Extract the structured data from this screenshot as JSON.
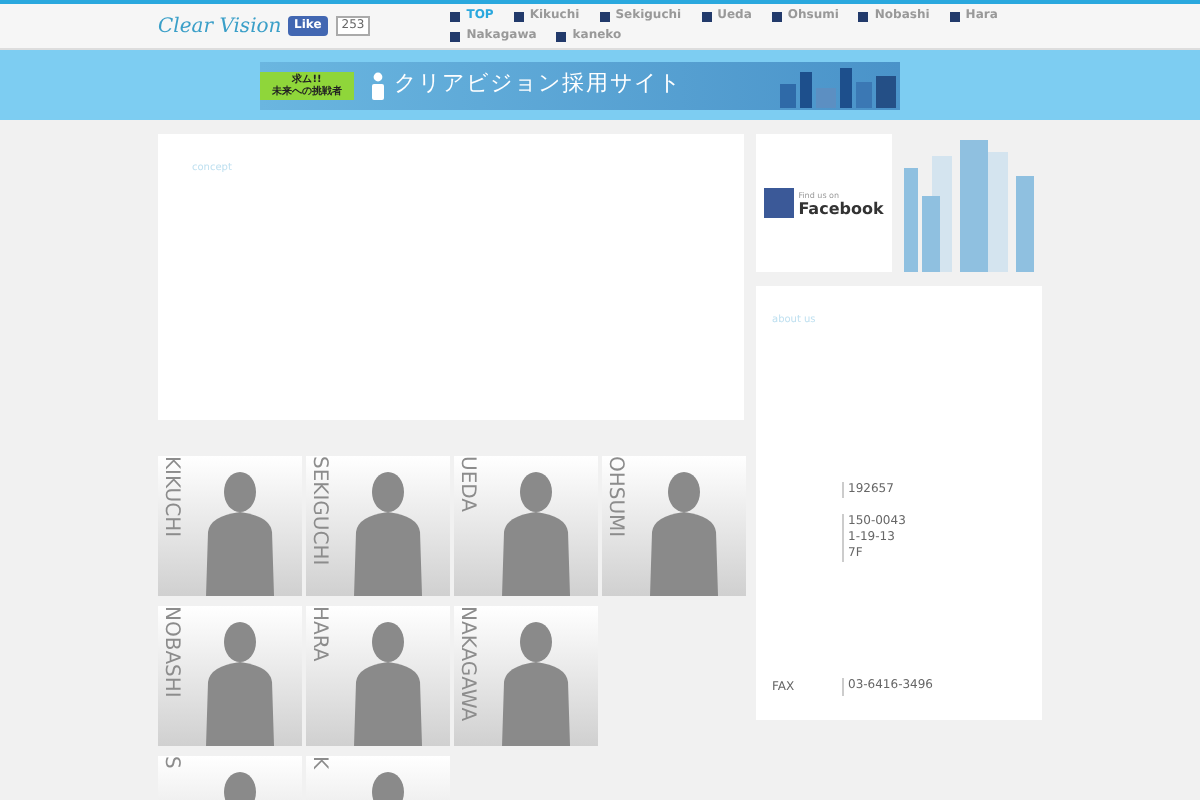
{
  "header": {
    "logo": "Clear Vision",
    "like": {
      "label": "Like",
      "count": "253"
    },
    "nav": [
      {
        "label": "TOP",
        "selected": true
      },
      {
        "label": "Kikuchi",
        "selected": false
      },
      {
        "label": "Sekiguchi",
        "selected": false
      },
      {
        "label": "Ueda",
        "selected": false
      },
      {
        "label": "Ohsumi",
        "selected": false
      },
      {
        "label": "Nobashi",
        "selected": false
      },
      {
        "label": "Hara",
        "selected": false
      },
      {
        "label": "Nakagawa",
        "selected": false
      },
      {
        "label": "kaneko",
        "selected": false
      }
    ]
  },
  "banner": {
    "tag": "求ム!!",
    "tag_sub": "未来への挑戦者",
    "title": "クリアビジョン採用サイト"
  },
  "concept": {
    "heading": "concept"
  },
  "member_rows": [
    [
      {
        "name": "KIKUCHI"
      },
      {
        "name": "SEKIGUCHI"
      },
      {
        "name": "UEDA"
      },
      {
        "name": "OHSUMI"
      }
    ],
    [
      {
        "name": "NOBASHI"
      },
      {
        "name": "HARA"
      },
      {
        "name": "NAKAGAWA"
      }
    ],
    [
      {
        "name": "S"
      },
      {
        "name": "K"
      }
    ]
  ],
  "facebook": {
    "small": "Find us on",
    "big": "Facebook"
  },
  "about": {
    "heading": "about us",
    "rows": [
      {
        "label": "",
        "lines": [
          "192657"
        ]
      },
      {
        "label": "",
        "lines": [
          "150-0043",
          "1-19-13",
          "7F"
        ]
      },
      {
        "label": "FAX",
        "lines": [
          "03-6416-3496"
        ]
      }
    ]
  }
}
